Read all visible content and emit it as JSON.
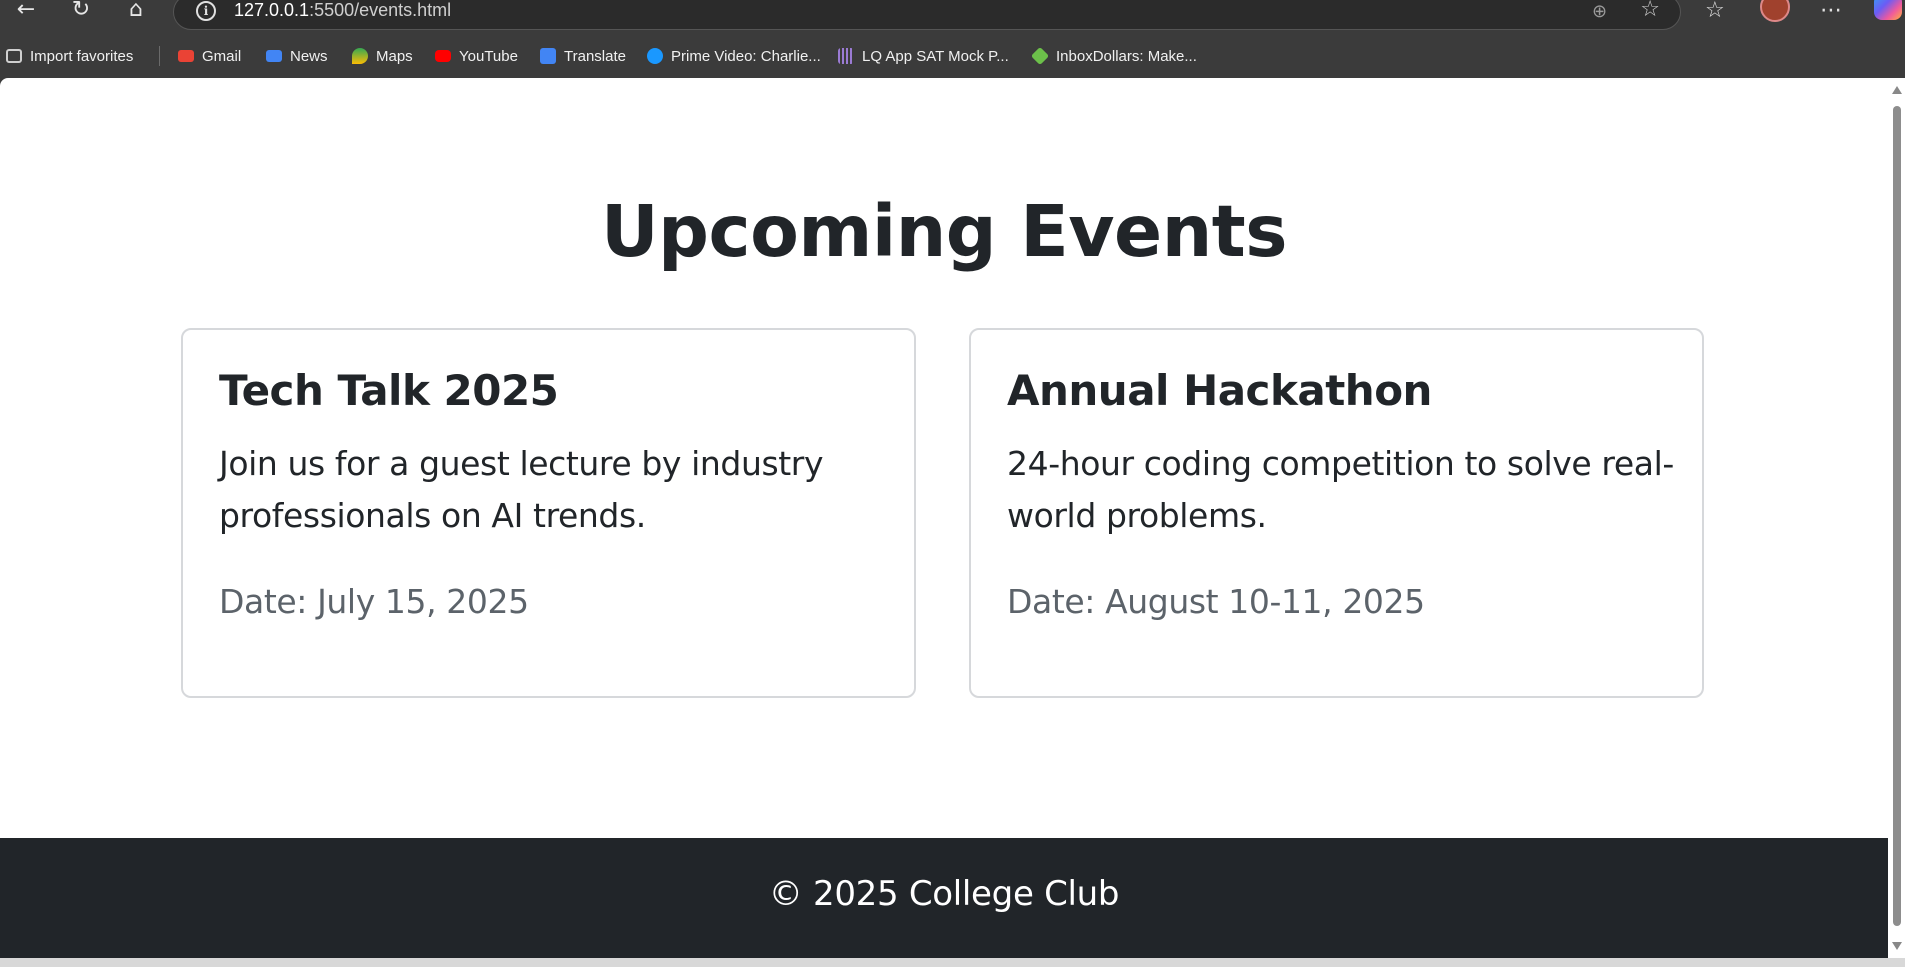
{
  "browser": {
    "url_host": "127.0.0.1",
    "url_rest": ":5500/events.html",
    "bookmarks": [
      {
        "label": "Import favorites",
        "icon": "import-icon",
        "color": "#cfcfcf"
      },
      {
        "label": "Gmail",
        "icon": "gmail-icon",
        "color": "#ea4335"
      },
      {
        "label": "News",
        "icon": "news-icon",
        "color": "#4285f4"
      },
      {
        "label": "Maps",
        "icon": "maps-icon",
        "color": "#34a853"
      },
      {
        "label": "YouTube",
        "icon": "youtube-icon",
        "color": "#ff0000"
      },
      {
        "label": "Translate",
        "icon": "translate-icon",
        "color": "#4285f4"
      },
      {
        "label": "Prime Video: Charlie...",
        "icon": "prime-video-icon",
        "color": "#1a98ff"
      },
      {
        "label": "LQ App SAT Mock P...",
        "icon": "lq-app-icon",
        "color": "#9b7bd4"
      },
      {
        "label": "InboxDollars: Make...",
        "icon": "inboxdollars-icon",
        "color": "#6cc04a"
      }
    ]
  },
  "page": {
    "title": "Upcoming Events",
    "events": [
      {
        "title": "Tech Talk 2025",
        "description": "Join us for a guest lecture by industry professionals on AI trends.",
        "date": "Date: July 15, 2025"
      },
      {
        "title": "Annual Hackathon",
        "description": "24-hour coding competition to solve real-world problems.",
        "date": "Date: August 10-11, 2025"
      }
    ],
    "footer": "© 2025 College Club"
  },
  "colors": {
    "text": "#212529",
    "muted": "#5c636a",
    "footer_bg": "#212529",
    "card_border": "#d6d8db"
  }
}
